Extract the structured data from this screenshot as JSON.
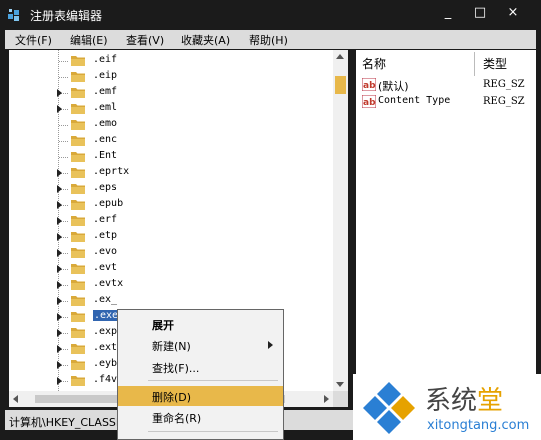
{
  "window": {
    "title": "注册表编辑器",
    "controls": [
      "_",
      "□",
      "×"
    ]
  },
  "menu": [
    "文件(F)",
    "编辑(E)",
    "查看(V)",
    "收藏夹(A)",
    "帮助(H)"
  ],
  "tree": {
    "items": [
      {
        "label": ".eif",
        "expandable": false,
        "selected": false
      },
      {
        "label": ".eip",
        "expandable": false,
        "selected": false
      },
      {
        "label": ".emf",
        "expandable": true,
        "selected": false
      },
      {
        "label": ".eml",
        "expandable": true,
        "selected": false
      },
      {
        "label": ".emo",
        "expandable": false,
        "selected": false
      },
      {
        "label": ".enc",
        "expandable": false,
        "selected": false
      },
      {
        "label": ".Ent",
        "expandable": false,
        "selected": false
      },
      {
        "label": ".eprtx",
        "expandable": true,
        "selected": false
      },
      {
        "label": ".eps",
        "expandable": true,
        "selected": false
      },
      {
        "label": ".epub",
        "expandable": true,
        "selected": false
      },
      {
        "label": ".erf",
        "expandable": true,
        "selected": false
      },
      {
        "label": ".etp",
        "expandable": true,
        "selected": false
      },
      {
        "label": ".evo",
        "expandable": true,
        "selected": false
      },
      {
        "label": ".evt",
        "expandable": true,
        "selected": false
      },
      {
        "label": ".evtx",
        "expandable": true,
        "selected": false
      },
      {
        "label": ".ex_",
        "expandable": true,
        "selected": false
      },
      {
        "label": ".exe",
        "expandable": true,
        "selected": true
      },
      {
        "label": ".exp",
        "expandable": true,
        "selected": false
      },
      {
        "label": ".ext",
        "expandable": true,
        "selected": false
      },
      {
        "label": ".eyb",
        "expandable": true,
        "selected": false
      },
      {
        "label": ".f4v",
        "expandable": true,
        "selected": false
      }
    ]
  },
  "values_pane": {
    "headers": {
      "name": "名称",
      "type": "类型"
    },
    "rows": [
      {
        "name": "(默认)",
        "type": "REG_SZ",
        "icon": "ab-string-icon"
      },
      {
        "name": "Content Type",
        "type": "REG_SZ",
        "icon": "ab-string-icon"
      }
    ]
  },
  "status": "计算机\\HKEY_CLASSES",
  "context_menu": {
    "items": [
      {
        "label": "展开",
        "bold": true,
        "submenu": false,
        "hover": false
      },
      {
        "label": "新建(N)",
        "bold": false,
        "submenu": true,
        "hover": false
      },
      {
        "label": "查找(F)...",
        "bold": false,
        "submenu": false,
        "hover": false
      },
      {
        "label": "删除(D)",
        "bold": false,
        "submenu": false,
        "hover": true
      },
      {
        "label": "重命名(R)",
        "bold": false,
        "submenu": false,
        "hover": false
      }
    ]
  },
  "watermark": {
    "title_parts": [
      "系",
      "统",
      "堂"
    ],
    "url": "xitongtang.com"
  },
  "colors": {
    "titlebar": "#1b1b1b",
    "selection": "#3165b0",
    "menu_hover": "#e8b84a",
    "folder": "#e9c25a",
    "watermark_blue": "#2a7fd4",
    "watermark_orange": "#e6a200"
  }
}
